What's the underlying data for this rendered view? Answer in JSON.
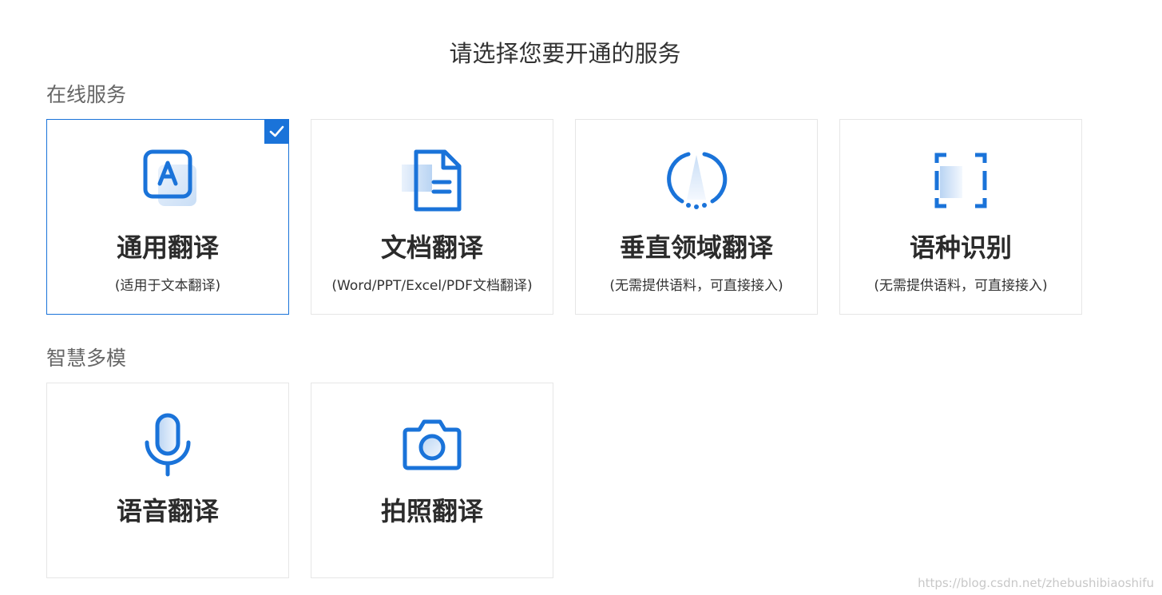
{
  "page_title": "请选择您要开通的服务",
  "sections": [
    {
      "title": "在线服务",
      "cards": [
        {
          "name": "通用翻译",
          "desc": "(适用于文本翻译)",
          "icon": "text-translate-icon",
          "selected": true
        },
        {
          "name": "文档翻译",
          "desc": "(Word/PPT/Excel/PDF文档翻译)",
          "icon": "document-icon",
          "selected": false
        },
        {
          "name": "垂直领域翻译",
          "desc": "(无需提供语料，可直接接入)",
          "icon": "compass-icon",
          "selected": false
        },
        {
          "name": "语种识别",
          "desc": "(无需提供语料，可直接接入)",
          "icon": "scan-frame-icon",
          "selected": false
        }
      ]
    },
    {
      "title": "智慧多模",
      "cards": [
        {
          "name": "语音翻译",
          "desc": "",
          "icon": "microphone-icon",
          "selected": false
        },
        {
          "name": "拍照翻译",
          "desc": "",
          "icon": "camera-icon",
          "selected": false
        }
      ]
    }
  ],
  "watermark": "https://blog.csdn.net/zhebushibiaoshifu",
  "colors": {
    "accent": "#1a73d9",
    "border": "#e6e6e6",
    "text": "#333333"
  }
}
